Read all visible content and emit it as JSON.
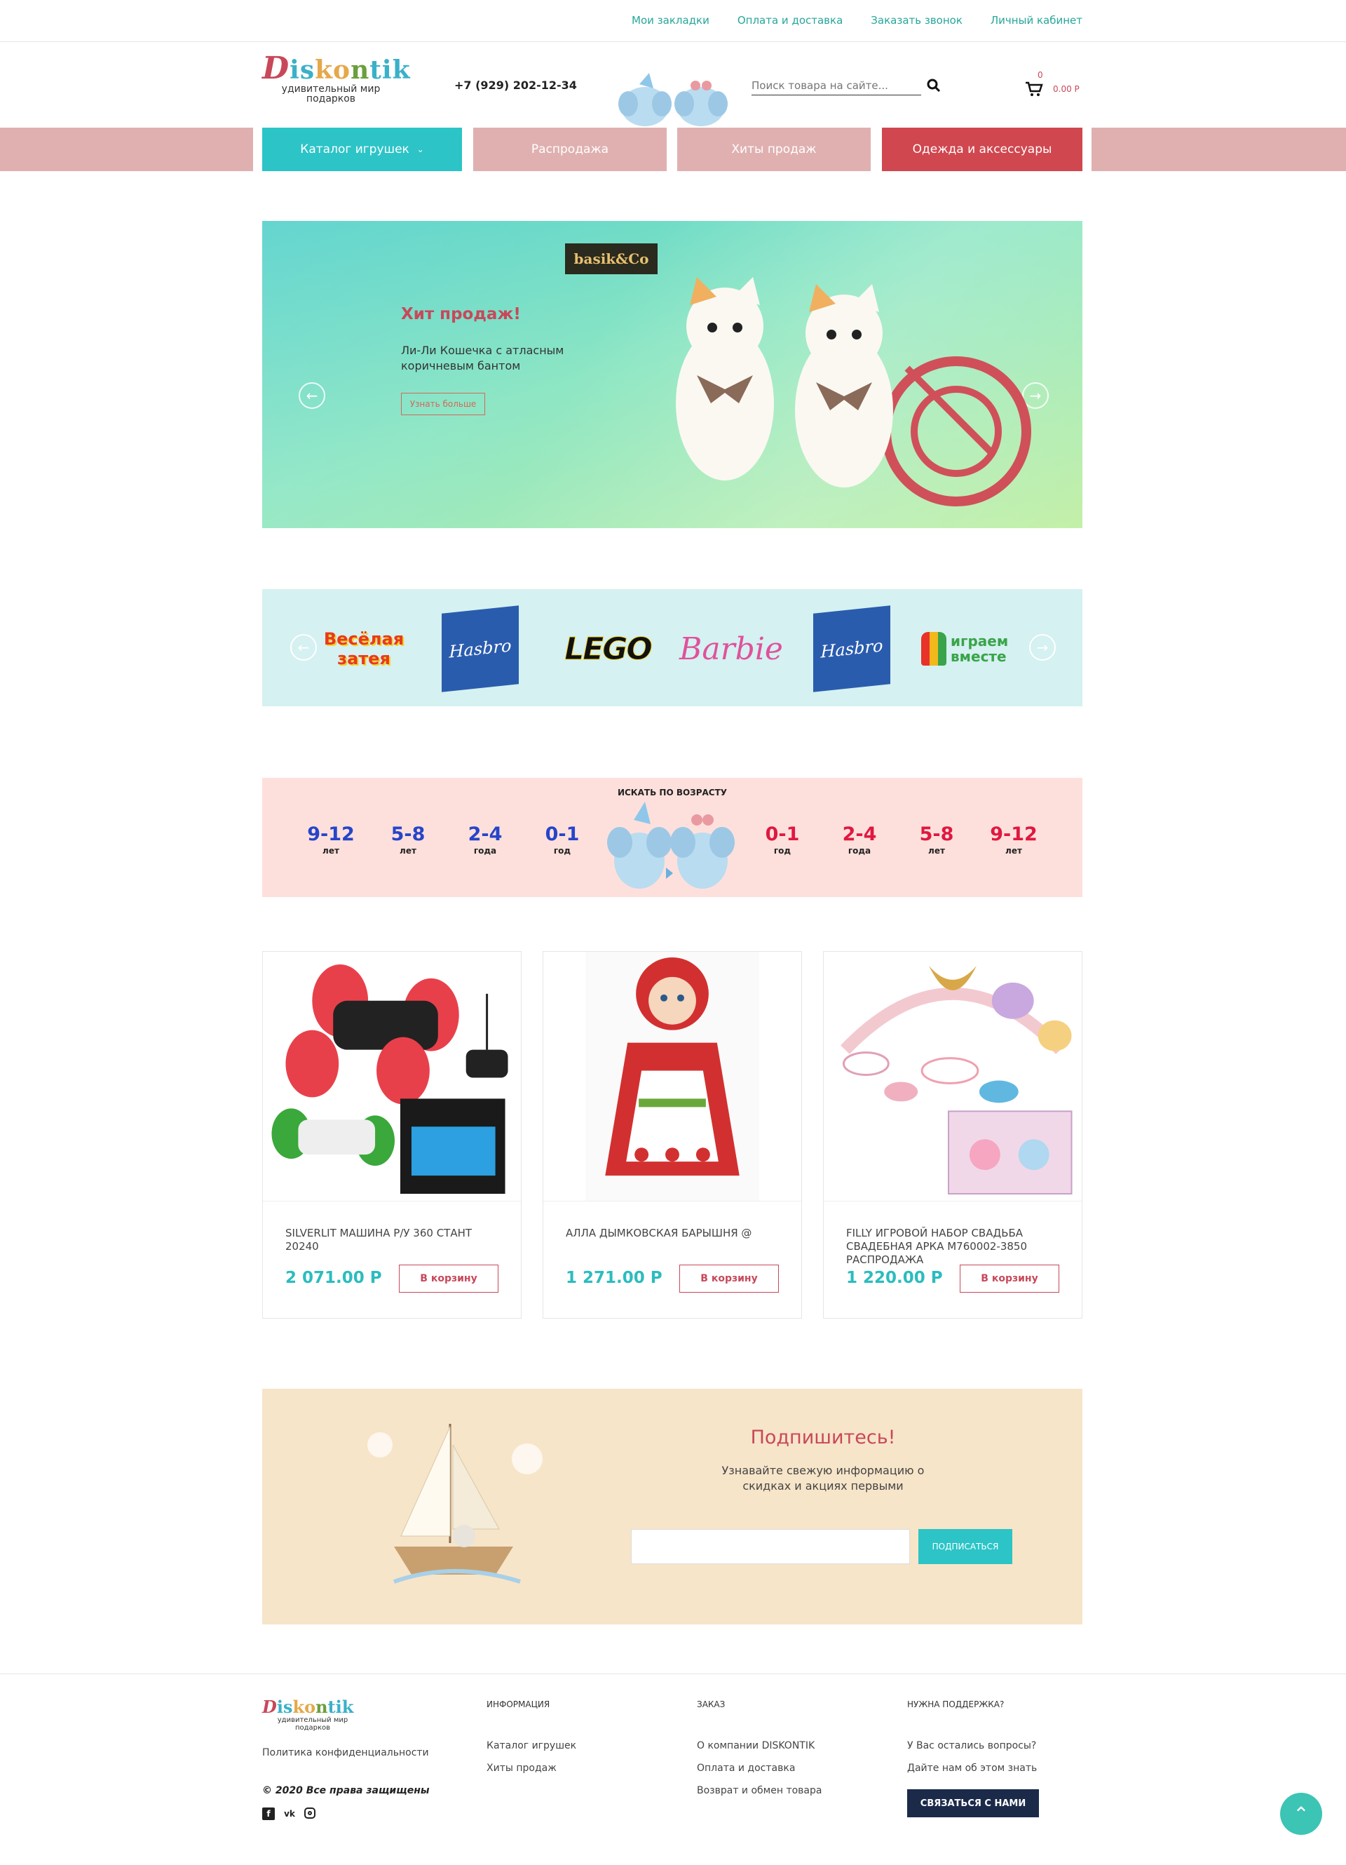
{
  "top_links": [
    "Мои закладки",
    "Оплата и доставка",
    "Заказать звонок",
    "Личный кабинет"
  ],
  "header": {
    "logo_text": "Diskontik",
    "logo_tagline": "удивительный мир подарков",
    "phone": "+7 (929) 202-12-34",
    "search_placeholder": "Поиск товара на сайте...",
    "cart_count": "0",
    "cart_total": "0.00 Р"
  },
  "nav": {
    "catalog": "Каталог игрушек",
    "sale": "Распродажа",
    "hits": "Хиты продаж",
    "clothes": "Одежда и аксессуары"
  },
  "hero": {
    "brand": "basik&Co",
    "title": "Хит продаж!",
    "description": "Ли-Ли Кошечка с атласным коричневым бантом",
    "button": "Узнать больше"
  },
  "brands": [
    "Весёлая затея",
    "Hasbro",
    "LEGO",
    "Barbie",
    "Hasbro",
    "играем вместе"
  ],
  "age": {
    "heading": "ИСКАТЬ ПО ВОЗРАСТУ",
    "boys": [
      {
        "num": "9-12",
        "unit": "лет"
      },
      {
        "num": "5-8",
        "unit": "лет"
      },
      {
        "num": "2-4",
        "unit": "года"
      },
      {
        "num": "0-1",
        "unit": "год"
      }
    ],
    "girls": [
      {
        "num": "0-1",
        "unit": "год"
      },
      {
        "num": "2-4",
        "unit": "года"
      },
      {
        "num": "5-8",
        "unit": "лет"
      },
      {
        "num": "9-12",
        "unit": "лет"
      }
    ]
  },
  "products": [
    {
      "name": "SILVERLIT МАШИНА Р/У 360 СТАНТ 20240",
      "price": "2 071.00 Р",
      "button": "В корзину"
    },
    {
      "name": "АЛЛА ДЫМКОВСКАЯ БАРЫШНЯ @",
      "price": "1 271.00 Р",
      "button": "В корзину"
    },
    {
      "name": "FILLY ИГРОВОЙ НАБОР СВАДЬБА СВАДЕБНАЯ АРКА M760002-3850 РАСПРОДАЖА",
      "price": "1 220.00 Р",
      "button": "В корзину"
    }
  ],
  "subscribe": {
    "title": "Подпишитесь!",
    "text": "Узнавайте свежую информацию о скидках и акциях первыми",
    "button": "ПОДПИСАТЬСЯ"
  },
  "footer": {
    "privacy": "Политика конфиденциальности",
    "rights": "© 2020 Все права защищены",
    "col1": {
      "heading": "ИНФОРМАЦИЯ",
      "links": [
        "Каталог игрушек",
        "Хиты продаж"
      ]
    },
    "col2": {
      "heading": "ЗАКАЗ",
      "links": [
        "О компании DISKONTIK",
        "Оплата и доставка",
        "Возврат и обмен товара"
      ]
    },
    "col3": {
      "heading": "НУЖНА ПОДДЕРЖКА?",
      "links": [
        "У Вас остались вопросы?",
        "Дайте нам об этом знать"
      ]
    },
    "contact_button": "СВЯЗАТЬСЯ С НАМИ"
  },
  "colors": {
    "accent": "#2cc4c7",
    "brand_red": "#c8485a",
    "nav_pink": "#e0b0b0",
    "nav_red": "#d0474f",
    "dark_button": "#1c2a4a"
  }
}
